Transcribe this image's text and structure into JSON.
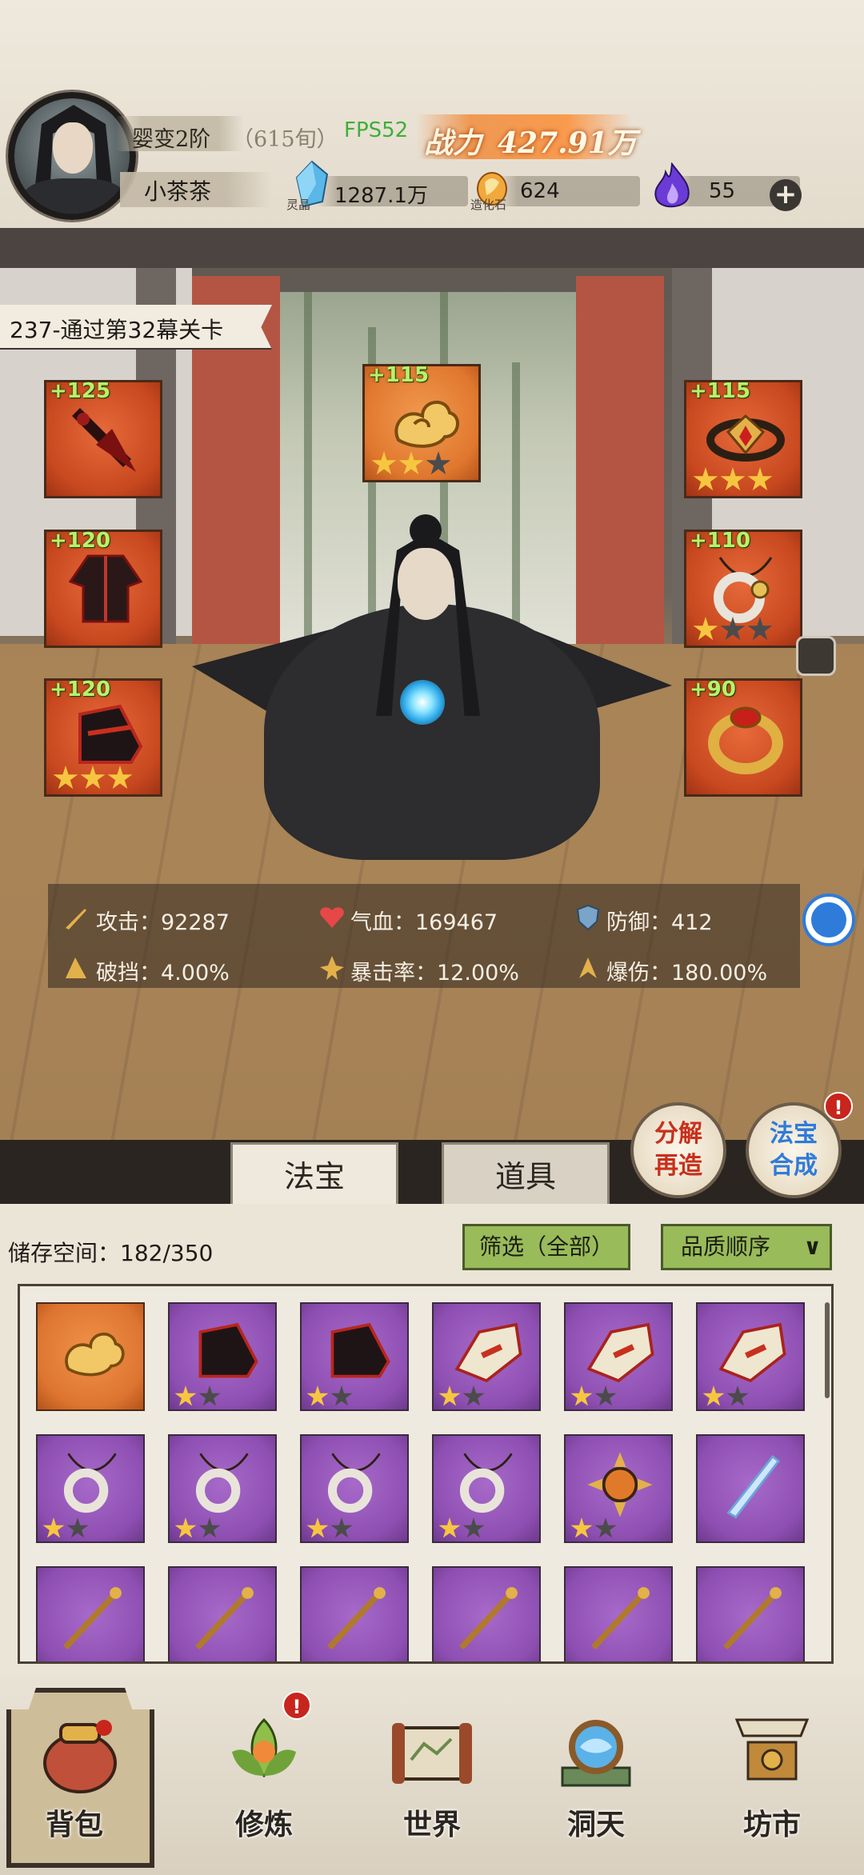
{
  "header": {
    "realm": "婴变2阶",
    "realm_sub": "（615旬）",
    "player_name": "小茶茶",
    "fps": "FPS52",
    "power_label": "战力",
    "power_value": "427.91万",
    "resources": [
      {
        "caption": "灵晶",
        "value": "1287.1万",
        "icon": "blue-crystal-icon"
      },
      {
        "caption": "造化石",
        "value": "624",
        "icon": "creation-stone-icon"
      },
      {
        "caption": "",
        "value": "55",
        "icon": "purple-flame-icon"
      }
    ]
  },
  "stage": {
    "label": "237-通过第32幕关卡"
  },
  "equipment": [
    {
      "slot": "weapon",
      "plus": "+125",
      "stars": 0
    },
    {
      "slot": "treasure",
      "plus": "+115",
      "stars": 2
    },
    {
      "slot": "headband",
      "plus": "+115",
      "stars": 3
    },
    {
      "slot": "armor",
      "plus": "+120",
      "stars": 0
    },
    {
      "slot": "necklace",
      "plus": "+110",
      "stars": 1
    },
    {
      "slot": "boots",
      "plus": "+120",
      "stars": 3
    },
    {
      "slot": "ring",
      "plus": "+90",
      "stars": 0
    }
  ],
  "stats": {
    "attack": "攻击：92287",
    "hp": "气血：169467",
    "defense": "防御：412",
    "break": "破挡：4.00%",
    "crit": "暴击率：12.00%",
    "crit_dmg": "爆伤：180.00%"
  },
  "actions": {
    "decompose_line1": "分解",
    "decompose_line2": "再造",
    "synth_line1": "法宝",
    "synth_line2": "合成",
    "synth_badge": "!"
  },
  "tabs": [
    {
      "label": "法宝",
      "active": true
    },
    {
      "label": "道具",
      "active": false
    }
  ],
  "inventory": {
    "storage": "储存空间：182/350",
    "filter": "筛选（全部）",
    "sort": "品质顺序",
    "sort_icon": "chevron-down-icon"
  },
  "nav": [
    {
      "label": "背包",
      "icon": "bag-icon",
      "active": true,
      "badge": ""
    },
    {
      "label": "修炼",
      "icon": "lotus-icon",
      "active": false,
      "badge": "!"
    },
    {
      "label": "世界",
      "icon": "scroll-map-icon",
      "active": false,
      "badge": ""
    },
    {
      "label": "洞天",
      "icon": "portal-icon",
      "active": false,
      "badge": ""
    },
    {
      "label": "坊市",
      "icon": "market-icon",
      "active": false,
      "badge": ""
    }
  ],
  "colors": {
    "accent_green": "#9abb5a",
    "purple_rarity": "#8e4fb2",
    "orange_rarity": "#dd7530",
    "star_gold": "#f7c640"
  }
}
